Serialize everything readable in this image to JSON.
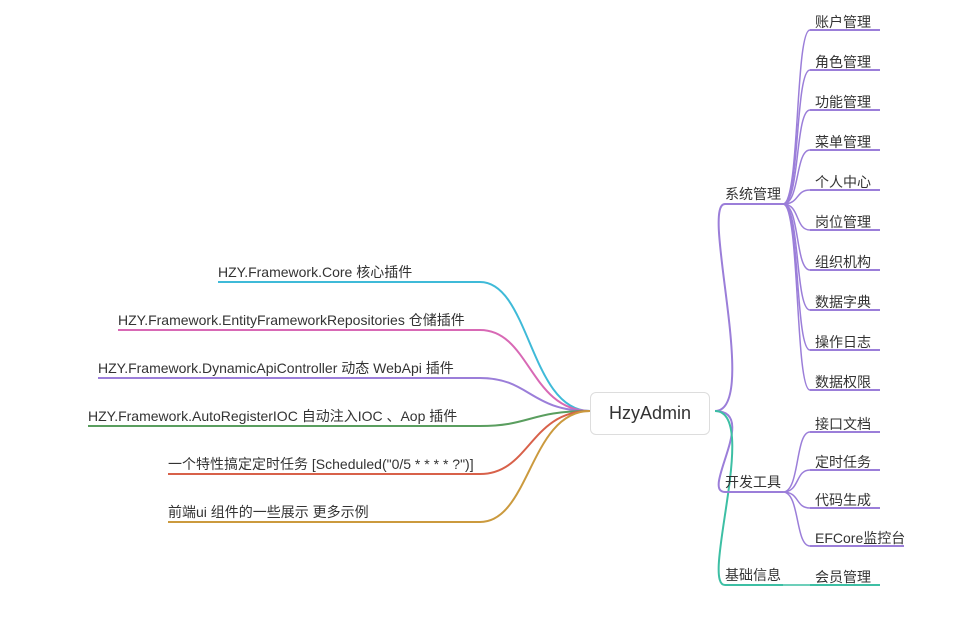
{
  "root": "HzyAdmin",
  "left": [
    {
      "label": "HZY.Framework.Core 核心插件",
      "color": "#3fbad8"
    },
    {
      "label": "HZY.Framework.EntityFrameworkRepositories 仓储插件",
      "color": "#d869b5"
    },
    {
      "label": "HZY.Framework.DynamicApiController 动态 WebApi 插件",
      "color": "#9b7ed9"
    },
    {
      "label": "HZY.Framework.AutoRegisterIOC 自动注入IOC 、Aop 插件",
      "color": "#5a9e5f"
    },
    {
      "label": "一个特性搞定定时任务 [Scheduled(\"0/5 * * * * ?\")]",
      "color": "#d8614a"
    },
    {
      "label": "前端ui 组件的一些展示           更多示例",
      "color": "#cb9a3e"
    }
  ],
  "right": {
    "group1": {
      "label": "系统管理",
      "color": "#9b7ed9",
      "children": [
        "账户管理",
        "角色管理",
        "功能管理",
        "菜单管理",
        "个人中心",
        "岗位管理",
        "组织机构",
        "数据字典",
        "操作日志",
        "数据权限"
      ]
    },
    "group2": {
      "label": "开发工具",
      "color": "#9b7ed9",
      "children": [
        "接口文档",
        "定时任务",
        "代码生成",
        "EFCore监控台"
      ]
    },
    "group3": {
      "label": "基础信息",
      "color": "#3dbfa4",
      "children": [
        "会员管理"
      ]
    }
  }
}
